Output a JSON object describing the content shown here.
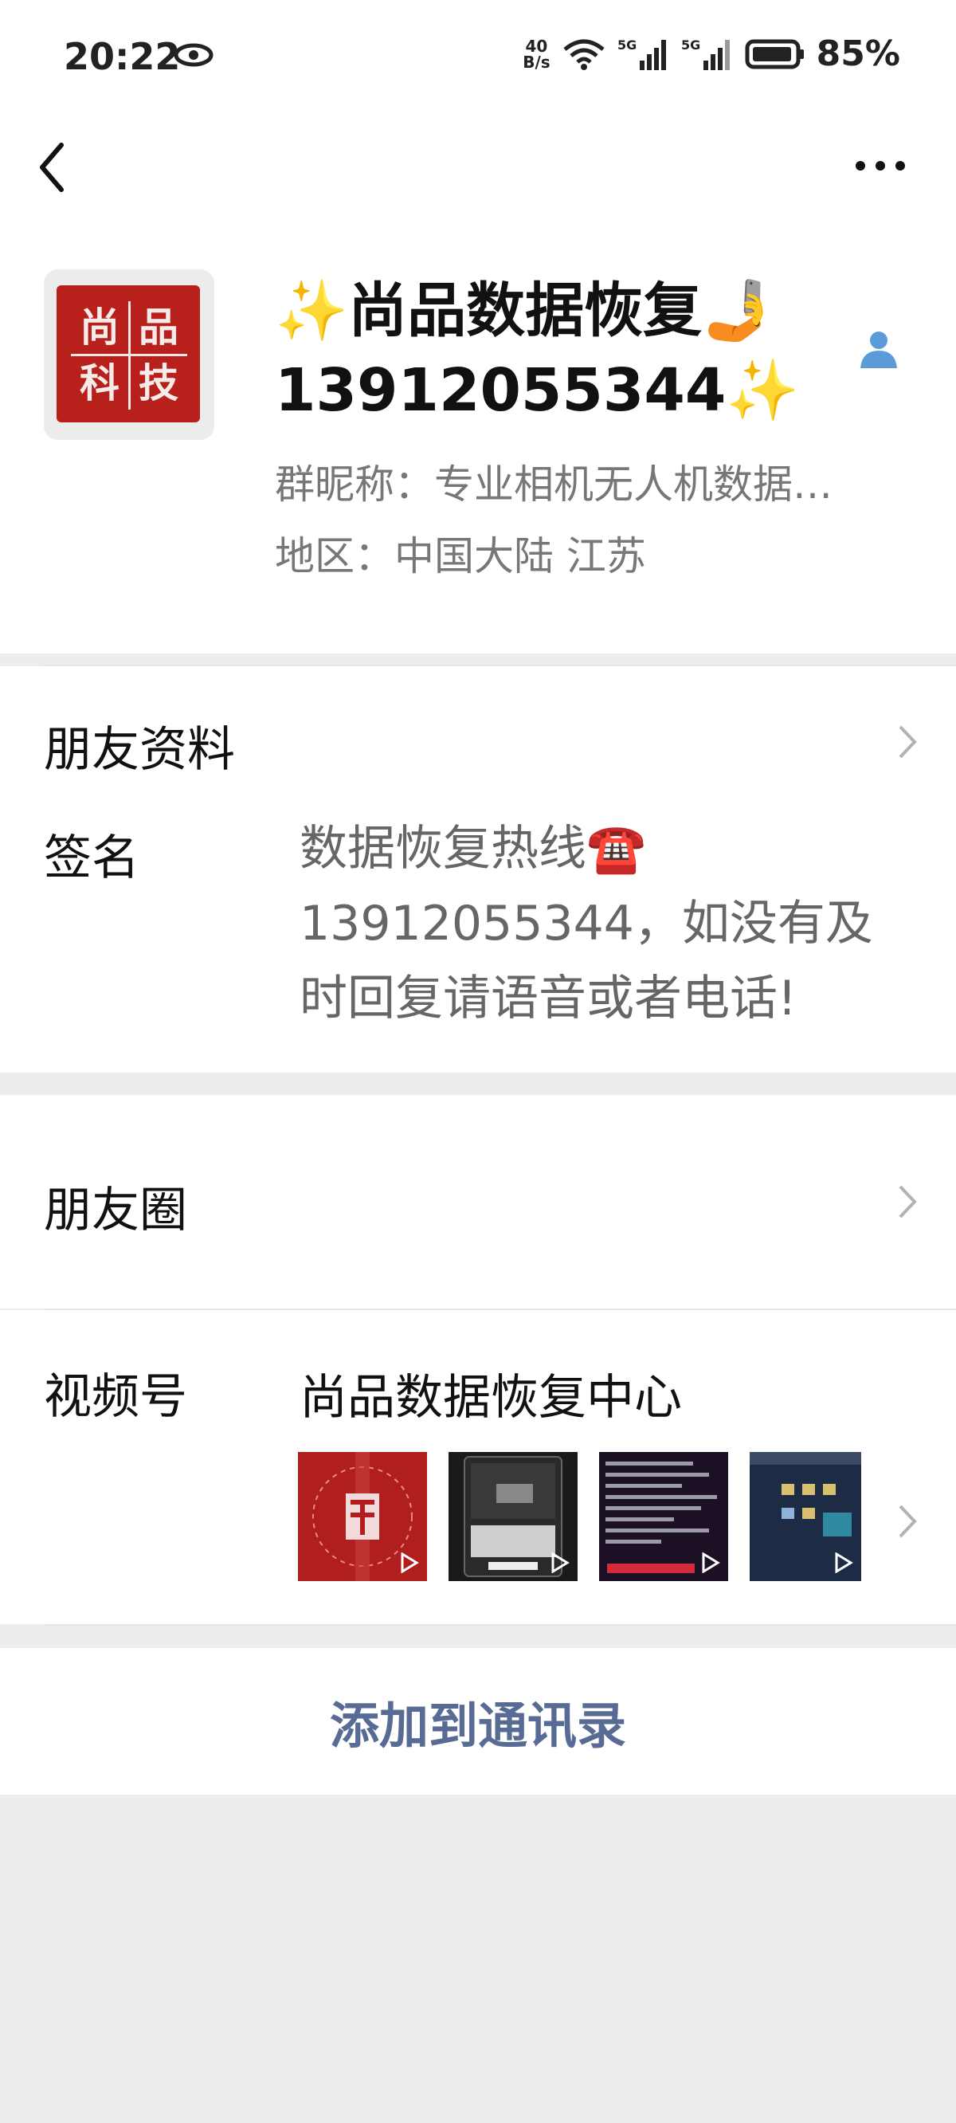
{
  "status_bar": {
    "time": "20:22",
    "net_speed_value": "40",
    "net_speed_unit": "B/s",
    "battery": "85%"
  },
  "profile": {
    "name_line1": "✨尚品数据恢复🤳",
    "name_line2": "13912055344✨",
    "nickname": "群昵称：专业相机无人机数据…",
    "region": "地区：中国大陆 江苏",
    "avatar_text": [
      "尚",
      "品",
      "科",
      "技"
    ]
  },
  "rows": {
    "friend_info": "朋友资料",
    "signature_label": "签名",
    "signature_lines": [
      "数据恢复热线☎️",
      "13912055344，如没有及",
      "时回复请语音或者电话!"
    ],
    "moments": "朋友圈",
    "channels_label": "视频号",
    "channels_name": "尚品数据恢复中心"
  },
  "actions": {
    "add_to_contacts": "添加到通讯录"
  },
  "colors": {
    "link_blue": "#576b95",
    "seal_red": "#b8201c",
    "background_gray": "#ededed"
  }
}
